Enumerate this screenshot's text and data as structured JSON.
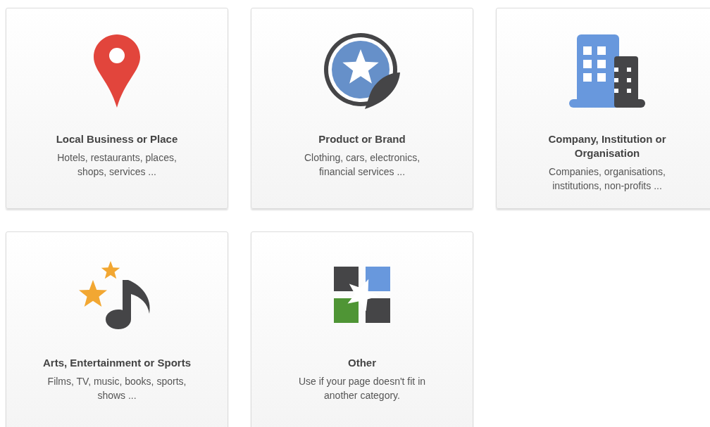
{
  "categories": [
    {
      "kind": "place",
      "title": [
        "Local Business or Place"
      ],
      "description": [
        "Hotels, restaurants, places,",
        "shops, services ..."
      ]
    },
    {
      "kind": "brand",
      "title": [
        "Product or Brand"
      ],
      "description": [
        "Clothing, cars, electronics,",
        "financial services ..."
      ]
    },
    {
      "kind": "company",
      "title": [
        "Company, Institution or",
        "Organisation"
      ],
      "description": [
        "Companies, organisations,",
        "institutions, non-profits ..."
      ]
    },
    {
      "kind": "arts",
      "title": [
        "Arts, Entertainment or Sports"
      ],
      "description": [
        "Films, TV, music, books, sports,",
        "shows ..."
      ]
    },
    {
      "kind": "other",
      "title": [
        "Other"
      ],
      "description": [
        "Use if your page doesn't fit in",
        "another category."
      ]
    }
  ]
}
